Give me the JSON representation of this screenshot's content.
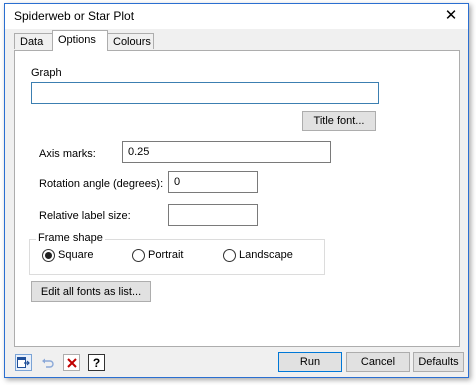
{
  "window": {
    "title": "Spiderweb or Star Plot",
    "close_glyph": "✕"
  },
  "tabs": [
    {
      "label": "Data"
    },
    {
      "label": "Options"
    },
    {
      "label": "Colours"
    }
  ],
  "graph": {
    "label": "Graph",
    "value": ""
  },
  "title_font_button": "Title font...",
  "axis_marks": {
    "label": "Axis marks:",
    "value": "0.25"
  },
  "rotation_angle": {
    "label": "Rotation angle (degrees):",
    "value": "0"
  },
  "relative_label_size": {
    "label": "Relative label size:",
    "value": ""
  },
  "frame_shape": {
    "label": "Frame shape",
    "options": [
      {
        "label": "Square",
        "selected": true
      },
      {
        "label": "Portrait",
        "selected": false
      },
      {
        "label": "Landscape",
        "selected": false
      }
    ]
  },
  "edit_fonts_button": "Edit all fonts as list...",
  "footer": {
    "run_label": "Run",
    "cancel_label": "Cancel",
    "defaults_label": "Defaults",
    "help_glyph": "?"
  },
  "colors": {
    "accent": "#0078d7",
    "window_border": "#2b6fd1"
  }
}
